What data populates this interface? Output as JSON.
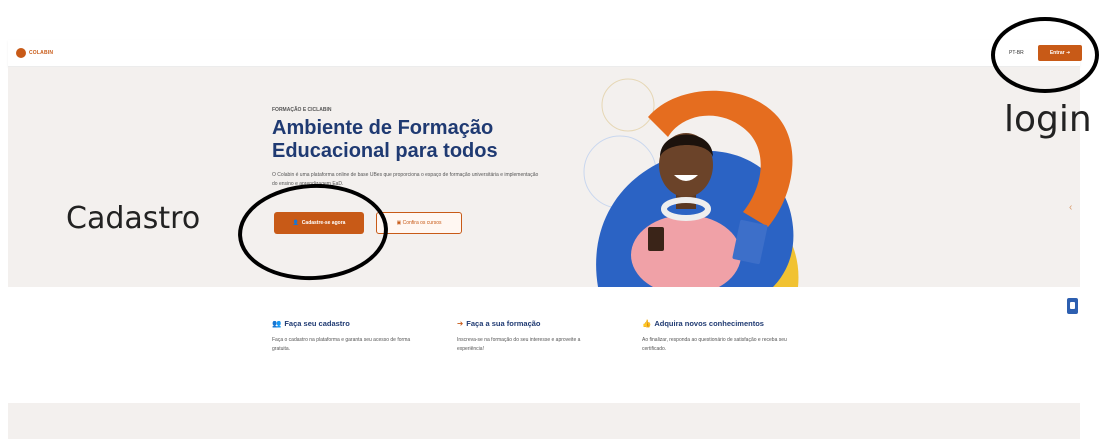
{
  "navbar": {
    "logo_text": "COLABIN",
    "lang": "PT-BR",
    "enter_button": "Entrar",
    "enter_icon": "arrow-right-icon"
  },
  "hero": {
    "eyebrow": "FORMAÇÃO E CICLABIN",
    "title": "Ambiente de Formação Educacional para todos",
    "description": "O Colabin é uma plataforma online de base UBes que proporciona o espaço de formação universitária e implementação do ensino e aprendizagem EaD.",
    "primary_button": "Cadastre-se agora",
    "secondary_button": "Confira os cursos"
  },
  "steps": [
    {
      "title": "Faça seu cadastro",
      "icon": "user-plus-icon",
      "text": "Faça o cadastro na plataforma e garanta seu acesso de forma gratuita."
    },
    {
      "title": "Faça a sua formação",
      "icon": "sign-in-icon",
      "text": "Inscreva-se na formação do seu interesse e aproveite a experiência!"
    },
    {
      "title": "Adquira novos conhecimentos",
      "icon": "hand-thumbs-up-icon",
      "text": "Ao finalizar, responda ao questionário de satisfação e receba seu certificado."
    }
  ],
  "annotations": {
    "login": "login",
    "cadastro": "Cadastro"
  },
  "colors": {
    "brand_orange": "#c85a17",
    "title_blue": "#1f3a72",
    "hero_bg": "#f3f0ee",
    "art_orange": "#e56d1f",
    "art_blue": "#2b63c4",
    "art_yellow": "#f1c232"
  }
}
